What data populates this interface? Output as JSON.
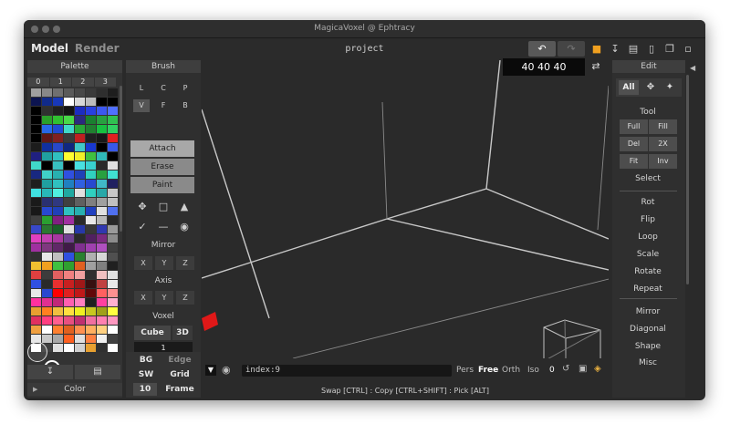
{
  "window": {
    "title": "MagicaVoxel @ Ephtracy"
  },
  "menubar": {
    "model": "Model",
    "render": "Render",
    "project": "project"
  },
  "icons": {
    "undo": "undo-icon",
    "redo": "redo-icon",
    "save": "save-icon",
    "export": "export-icon",
    "open": "folder-icon",
    "new": "new-file-icon",
    "copy": "copy-icon",
    "delete": "trash-icon"
  },
  "palette": {
    "header": "Palette",
    "pages": [
      "0",
      "1",
      "2",
      "3"
    ],
    "footer": {
      "label": "Color"
    },
    "colors": [
      "#a0a0a0",
      "#888888",
      "#707070",
      "#5a5a5a",
      "#484848",
      "#3a3a3a",
      "#2e2e2e",
      "#1e1e1e",
      "#0c1450",
      "#102a8a",
      "#1838b8",
      "#ffffff",
      "#d8d8d8",
      "#bcbcbc",
      "#000000",
      "#000000",
      "#000000",
      "#303030",
      "#202020",
      "#141414",
      "#1c2cc0",
      "#2840e0",
      "#3c58f0",
      "#5070ff",
      "#000000",
      "#2aa02a",
      "#30c030",
      "#48d848",
      "#2a2a80",
      "#1a8030",
      "#28a040",
      "#30c050",
      "#000000",
      "#2868e8",
      "#204ad0",
      "#40d8c8",
      "#28a838",
      "#208030",
      "#18c040",
      "#30d060",
      "#000000",
      "#601818",
      "#802020",
      "#3a3a3a",
      "#c02020",
      "#202020",
      "#181818",
      "#e02020",
      "#1c1c1c",
      "#1030a0",
      "#2848c8",
      "#102880",
      "#40c8c8",
      "#1838d0",
      "#000000",
      "#3858e8",
      "#202080",
      "#20a0a0",
      "#30c0c0",
      "#ffff30",
      "#f0f028",
      "#40c040",
      "#30b8b8",
      "#000000",
      "#40d8c8",
      "#000000",
      "#38c0c0",
      "#000000",
      "#48e0e0",
      "#38d0d0",
      "#2a2a2a",
      "#e0e0e0",
      "#182880",
      "#40d0c8",
      "#28b0b0",
      "#3050e0",
      "#2040b8",
      "#30d0c0",
      "#28a040",
      "#40e0d0",
      "#1e1e1e",
      "#20a0a0",
      "#30c0c0",
      "#2080c0",
      "#3060e0",
      "#2848d0",
      "#40b8c8",
      "#202060",
      "#40e0e0",
      "#28b8b8",
      "#50f0e0",
      "#20a8a0",
      "#e0e0e0",
      "#30d0c0",
      "#28a8a8",
      "#c8c8c8",
      "#1a1a1a",
      "#2a3070",
      "#303880",
      "#404040",
      "#606060",
      "#808080",
      "#a0a0a0",
      "#c0c0c0",
      "#181818",
      "#2848d0",
      "#2040b8",
      "#30c0c0",
      "#28b0b0",
      "#2040c0",
      "#e0e0e0",
      "#5070f0",
      "#404040",
      "#2aa030",
      "#802080",
      "#a030a0",
      "#2a2a2a",
      "#e8e8e8",
      "#b8b8b8",
      "#282828",
      "#3848c8",
      "#2a7830",
      "#1a6028",
      "#e0e0e0",
      "#2838a8",
      "#383838",
      "#3038b0",
      "#9a9a9a",
      "#e040c0",
      "#c040b0",
      "#a838a0",
      "#704090",
      "#2a2a2a",
      "#502060",
      "#7a2a80",
      "#8c8c8c",
      "#a030a0",
      "#803880",
      "#602868",
      "#401a48",
      "#803090",
      "#a040b0",
      "#b050c0",
      "#404040",
      "#303030",
      "#e8e8e8",
      "#c0c0c0",
      "#3050e0",
      "#2a8030",
      "#b0b0b0",
      "#d8d8d8",
      "#505050",
      "#f0c030",
      "#f0a020",
      "#40c040",
      "#30a030",
      "#e06020",
      "#a0a0a0",
      "#808080",
      "#202020",
      "#e04040",
      "#3c3c3c",
      "#e06060",
      "#f08080",
      "#f0a0a0",
      "#303030",
      "#f0c0c0",
      "#e0e0e0",
      "#3050e0",
      "#2a2a2a",
      "#e83030",
      "#c82020",
      "#a01818",
      "#381010",
      "#c04040",
      "#e8e8e8",
      "#e8e8e8",
      "#2848d0",
      "#ff0000",
      "#e02020",
      "#c01818",
      "#600808",
      "#ff6060",
      "#ff9090",
      "#ff30a0",
      "#e03090",
      "#c02878",
      "#ff60b0",
      "#ff80c0",
      "#202020",
      "#ff40a0",
      "#ffb0d0",
      "#e8a030",
      "#ff8020",
      "#f0c040",
      "#ffe040",
      "#f0f020",
      "#c8c820",
      "#a0a018",
      "#ffff40",
      "#e03060",
      "#ff4080",
      "#ff6090",
      "#e85080",
      "#c03070",
      "#f070a0",
      "#ff80b0",
      "#ff98c0",
      "#f0a040",
      "#ffffff",
      "#ff8030",
      "#e06020",
      "#ff9050",
      "#ffb060",
      "#ffd080",
      "#ffffff",
      "#e8e8e8",
      "#c8c8c8",
      "#a8a8a8",
      "#ff6020",
      "#e0e0e0",
      "#ff8040",
      "#f0f0f0",
      "#404040",
      "#ffffff",
      "#404040",
      "#e0e0e0",
      "#ffffff",
      "#d0d0d0",
      "#e8a030",
      "#303030",
      "#ffffff"
    ]
  },
  "brush": {
    "header": "Brush",
    "shapes": [
      "L",
      "C",
      "P",
      "V",
      "F",
      "B"
    ],
    "modes": [
      "Attach",
      "Erase",
      "Paint"
    ],
    "mirror": {
      "label": "Mirror",
      "axes": [
        "X",
        "Y",
        "Z"
      ]
    },
    "axis": {
      "label": "Axis",
      "axes": [
        "X",
        "Y",
        "Z"
      ]
    },
    "voxel": {
      "label": "Voxel",
      "cube": "Cube",
      "three_d": "3D",
      "value": "1"
    },
    "bottom": {
      "bg": "BG",
      "edge": "Edge",
      "sw": "SW",
      "grid": "Grid",
      "size": "10",
      "frame": "Frame"
    }
  },
  "viewport": {
    "size_field": "40 40 40",
    "command": "index:9",
    "views": [
      "Pers",
      "Free",
      "Orth",
      "Iso"
    ],
    "zero": "0",
    "status": "Swap [CTRL] : Copy [CTRL+SHIFT] : Pick [ALT]"
  },
  "edit": {
    "header": "Edit",
    "all": "All",
    "tool_label": "Tool",
    "tool_grid": [
      "Full",
      "Fill",
      "Del",
      "2X",
      "Fit",
      "Inv"
    ],
    "select": "Select",
    "ops": [
      "Rot",
      "Flip",
      "Loop",
      "Scale",
      "Rotate",
      "Repeat"
    ],
    "ops2": [
      "Mirror",
      "Diagonal",
      "Shape",
      "Misc"
    ]
  }
}
